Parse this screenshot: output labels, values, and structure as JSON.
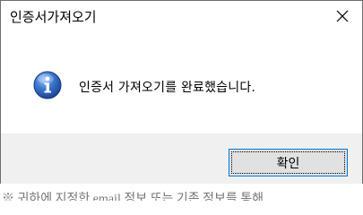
{
  "window": {
    "title": "인증서가져오기",
    "close_glyph": "✕"
  },
  "message": {
    "icon": "info-icon",
    "text": "인증서 가져오기를 완료했습니다."
  },
  "buttons": {
    "ok_label": "확인"
  },
  "background": {
    "partial_text": "※ 귀하에 지정한 email 정보 또는 기존 정보를 통해"
  },
  "colors": {
    "icon_blue": "#2a5fb6",
    "focus_border": "#0078d7",
    "footer_bg": "#f0f0f0"
  }
}
